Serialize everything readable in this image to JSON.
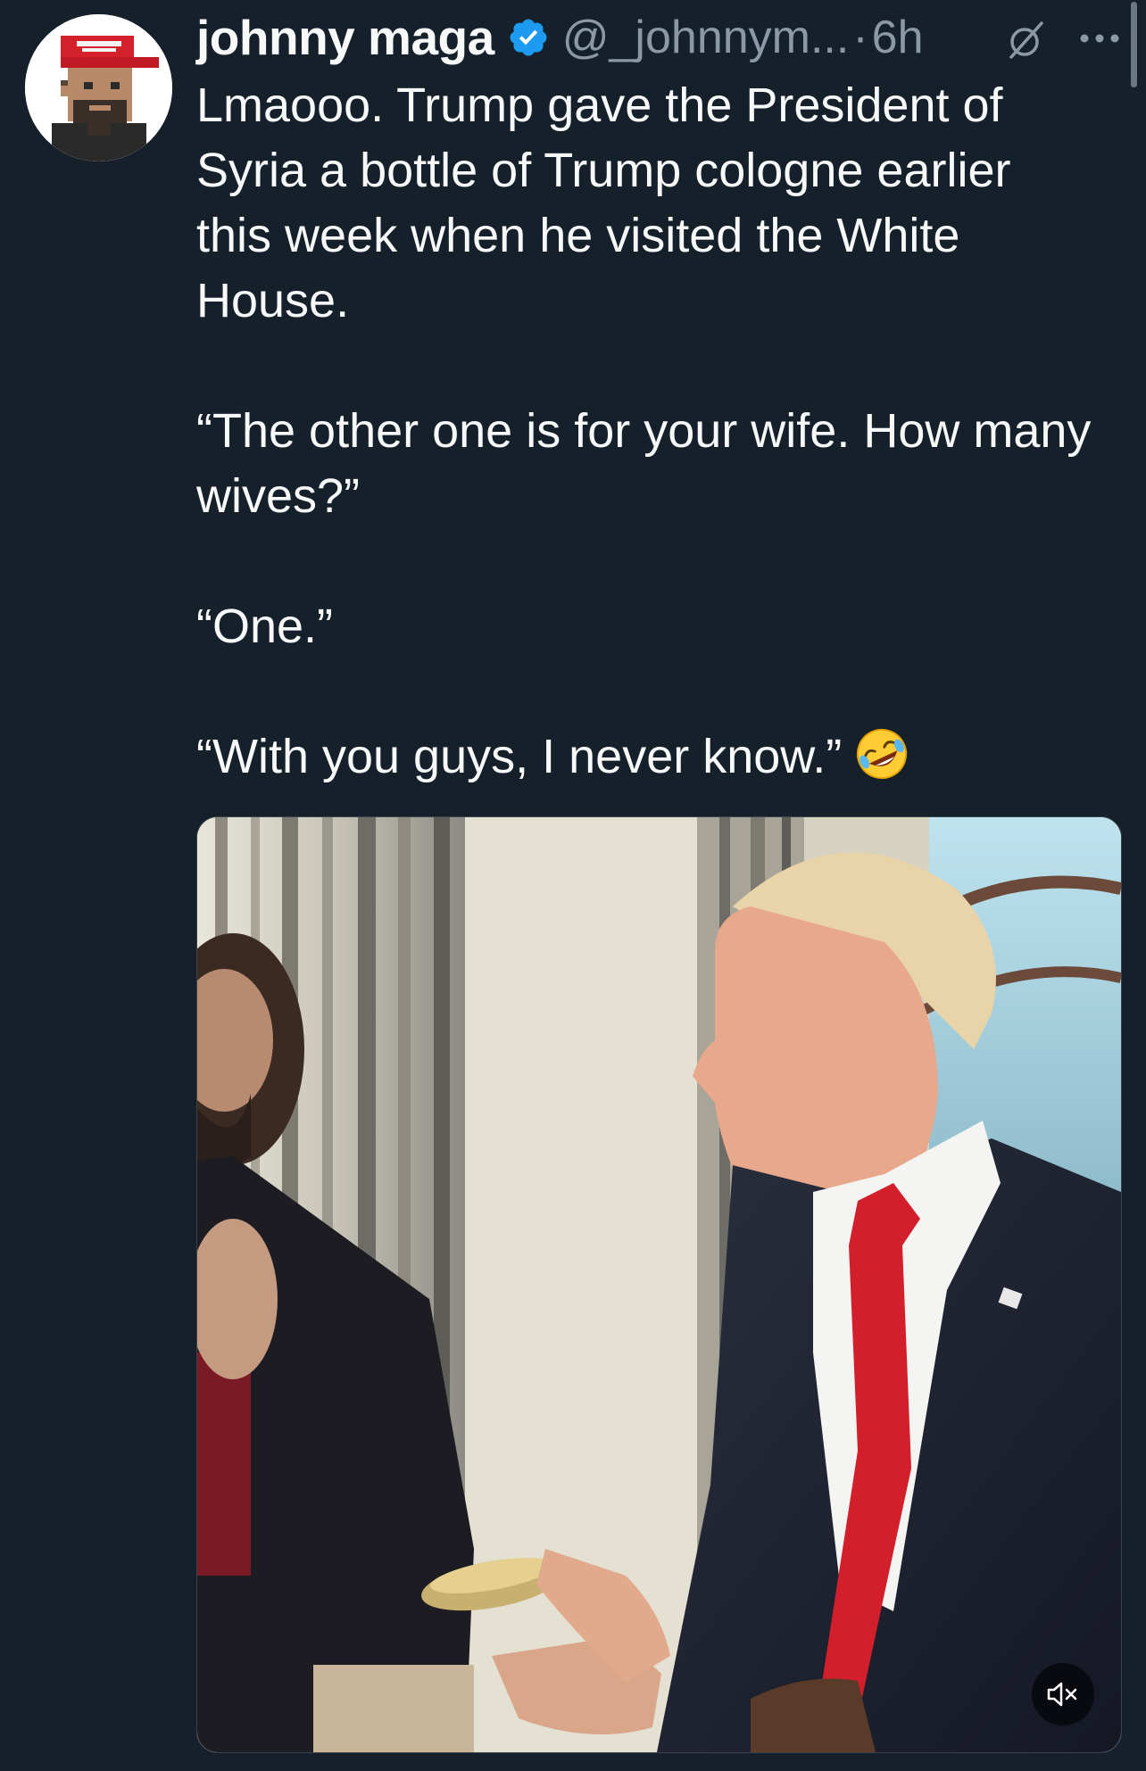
{
  "tweet": {
    "author": {
      "display_name": "johnny maga",
      "handle": "@_johnnym...",
      "verified": true,
      "avatar_icon": "maga-hat-pixel-avatar-icon"
    },
    "separator": "·",
    "timestamp": "6h",
    "icons": {
      "verified": "verified-badge-icon",
      "grok": "grok-icon",
      "more": "more-options-icon",
      "mute": "volume-muted-icon",
      "emoji": "rolling-on-floor-laughing-emoji"
    },
    "text": {
      "line1": "Lmaooo. Trump gave the President of Syria a bottle of Trump cologne earlier this week when he visited the White House.",
      "line2": "“The other one is for your wife. How many wives?”",
      "line3": "“One.”",
      "line4": "“With you guys, I never know.”"
    },
    "colors": {
      "background": "#15202b",
      "text": "#f7f9f9",
      "secondary_text": "#8b98a5",
      "verified_blue": "#1d9bf0"
    }
  }
}
